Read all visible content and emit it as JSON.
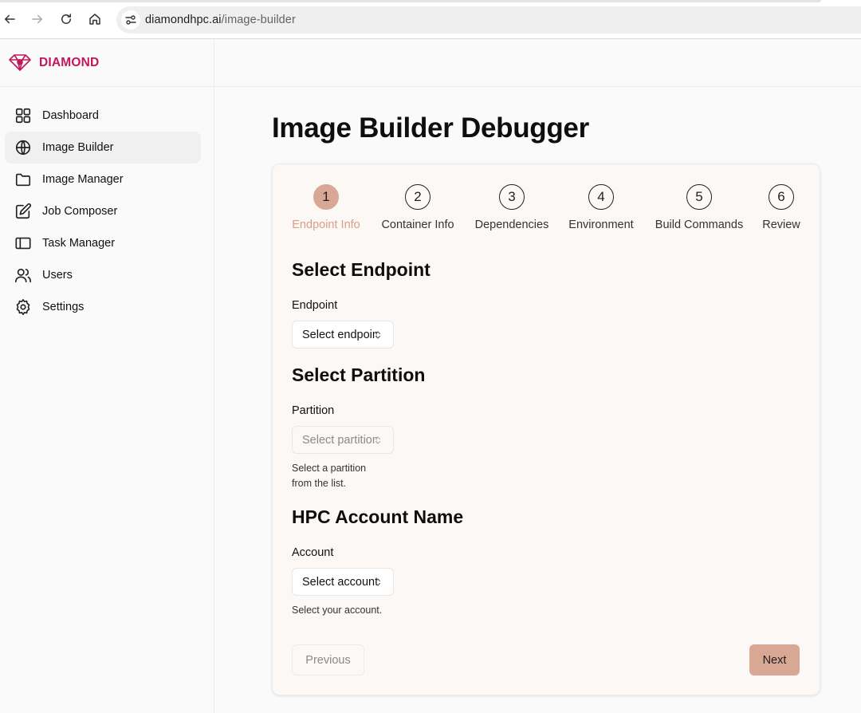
{
  "browser": {
    "url_host": "diamondhpc.ai",
    "url_path": "/image-builder"
  },
  "brand": {
    "name": "DIAMOND",
    "color": "#c2185b"
  },
  "sidebar": {
    "items": [
      {
        "label": "Dashboard",
        "icon": "dashboard-grid-icon",
        "active": false
      },
      {
        "label": "Image Builder",
        "icon": "globe-icon",
        "active": true
      },
      {
        "label": "Image Manager",
        "icon": "folder-icon",
        "active": false
      },
      {
        "label": "Job Composer",
        "icon": "edit-icon",
        "active": false
      },
      {
        "label": "Task Manager",
        "icon": "panels-icon",
        "active": false
      },
      {
        "label": "Users",
        "icon": "users-icon",
        "active": false
      },
      {
        "label": "Settings",
        "icon": "gear-icon",
        "active": false
      }
    ]
  },
  "page": {
    "title": "Image Builder Debugger"
  },
  "stepper": {
    "current": 1,
    "steps": [
      {
        "number": "1",
        "label": "Endpoint Info"
      },
      {
        "number": "2",
        "label": "Container Info"
      },
      {
        "number": "3",
        "label": "Dependencies"
      },
      {
        "number": "4",
        "label": "Environment"
      },
      {
        "number": "5",
        "label": "Build Commands"
      },
      {
        "number": "6",
        "label": "Review"
      }
    ]
  },
  "form": {
    "endpoint": {
      "heading": "Select Endpoint",
      "label": "Endpoint",
      "value": "Select endpoint"
    },
    "partition": {
      "heading": "Select Partition",
      "label": "Partition",
      "value": "Select partition",
      "helper_line1": "Select a partition",
      "helper_line2": "from the list."
    },
    "account": {
      "heading": "HPC Account Name",
      "label": "Account",
      "value": "Select account",
      "helper": "Select your account."
    }
  },
  "actions": {
    "previous": "Previous",
    "next": "Next"
  },
  "colors": {
    "accent": "#d9a894",
    "accent_text": "#d99e86",
    "card_bg": "#fcf8f6"
  }
}
